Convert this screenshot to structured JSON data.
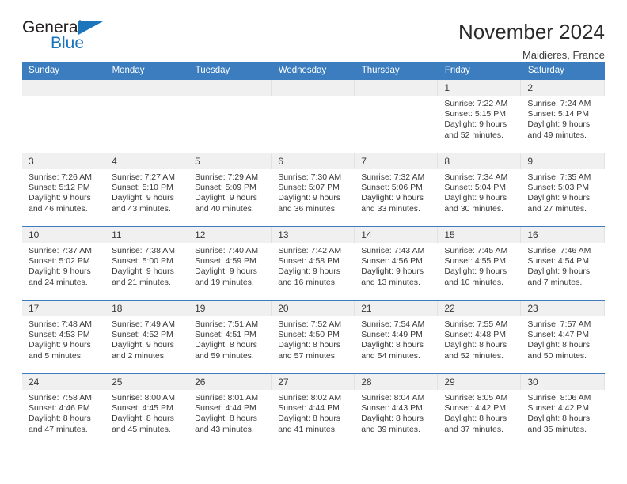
{
  "brand": {
    "name_top": "General",
    "name_bottom": "Blue",
    "accent_color": "#1b75bc"
  },
  "header": {
    "title": "November 2024",
    "subtitle": "Maidieres, France"
  },
  "calendar": {
    "header_color": "#3b7dbf",
    "weekday_headers": [
      "Sunday",
      "Monday",
      "Tuesday",
      "Wednesday",
      "Thursday",
      "Friday",
      "Saturday"
    ],
    "weeks": [
      [
        {
          "day": "",
          "sunrise": "",
          "sunset": "",
          "daylight": "",
          "empty": true
        },
        {
          "day": "",
          "sunrise": "",
          "sunset": "",
          "daylight": "",
          "empty": true
        },
        {
          "day": "",
          "sunrise": "",
          "sunset": "",
          "daylight": "",
          "empty": true
        },
        {
          "day": "",
          "sunrise": "",
          "sunset": "",
          "daylight": "",
          "empty": true
        },
        {
          "day": "",
          "sunrise": "",
          "sunset": "",
          "daylight": "",
          "empty": true
        },
        {
          "day": "1",
          "sunrise": "Sunrise: 7:22 AM",
          "sunset": "Sunset: 5:15 PM",
          "daylight": "Daylight: 9 hours and 52 minutes."
        },
        {
          "day": "2",
          "sunrise": "Sunrise: 7:24 AM",
          "sunset": "Sunset: 5:14 PM",
          "daylight": "Daylight: 9 hours and 49 minutes."
        }
      ],
      [
        {
          "day": "3",
          "sunrise": "Sunrise: 7:26 AM",
          "sunset": "Sunset: 5:12 PM",
          "daylight": "Daylight: 9 hours and 46 minutes."
        },
        {
          "day": "4",
          "sunrise": "Sunrise: 7:27 AM",
          "sunset": "Sunset: 5:10 PM",
          "daylight": "Daylight: 9 hours and 43 minutes."
        },
        {
          "day": "5",
          "sunrise": "Sunrise: 7:29 AM",
          "sunset": "Sunset: 5:09 PM",
          "daylight": "Daylight: 9 hours and 40 minutes."
        },
        {
          "day": "6",
          "sunrise": "Sunrise: 7:30 AM",
          "sunset": "Sunset: 5:07 PM",
          "daylight": "Daylight: 9 hours and 36 minutes."
        },
        {
          "day": "7",
          "sunrise": "Sunrise: 7:32 AM",
          "sunset": "Sunset: 5:06 PM",
          "daylight": "Daylight: 9 hours and 33 minutes."
        },
        {
          "day": "8",
          "sunrise": "Sunrise: 7:34 AM",
          "sunset": "Sunset: 5:04 PM",
          "daylight": "Daylight: 9 hours and 30 minutes."
        },
        {
          "day": "9",
          "sunrise": "Sunrise: 7:35 AM",
          "sunset": "Sunset: 5:03 PM",
          "daylight": "Daylight: 9 hours and 27 minutes."
        }
      ],
      [
        {
          "day": "10",
          "sunrise": "Sunrise: 7:37 AM",
          "sunset": "Sunset: 5:02 PM",
          "daylight": "Daylight: 9 hours and 24 minutes."
        },
        {
          "day": "11",
          "sunrise": "Sunrise: 7:38 AM",
          "sunset": "Sunset: 5:00 PM",
          "daylight": "Daylight: 9 hours and 21 minutes."
        },
        {
          "day": "12",
          "sunrise": "Sunrise: 7:40 AM",
          "sunset": "Sunset: 4:59 PM",
          "daylight": "Daylight: 9 hours and 19 minutes."
        },
        {
          "day": "13",
          "sunrise": "Sunrise: 7:42 AM",
          "sunset": "Sunset: 4:58 PM",
          "daylight": "Daylight: 9 hours and 16 minutes."
        },
        {
          "day": "14",
          "sunrise": "Sunrise: 7:43 AM",
          "sunset": "Sunset: 4:56 PM",
          "daylight": "Daylight: 9 hours and 13 minutes."
        },
        {
          "day": "15",
          "sunrise": "Sunrise: 7:45 AM",
          "sunset": "Sunset: 4:55 PM",
          "daylight": "Daylight: 9 hours and 10 minutes."
        },
        {
          "day": "16",
          "sunrise": "Sunrise: 7:46 AM",
          "sunset": "Sunset: 4:54 PM",
          "daylight": "Daylight: 9 hours and 7 minutes."
        }
      ],
      [
        {
          "day": "17",
          "sunrise": "Sunrise: 7:48 AM",
          "sunset": "Sunset: 4:53 PM",
          "daylight": "Daylight: 9 hours and 5 minutes."
        },
        {
          "day": "18",
          "sunrise": "Sunrise: 7:49 AM",
          "sunset": "Sunset: 4:52 PM",
          "daylight": "Daylight: 9 hours and 2 minutes."
        },
        {
          "day": "19",
          "sunrise": "Sunrise: 7:51 AM",
          "sunset": "Sunset: 4:51 PM",
          "daylight": "Daylight: 8 hours and 59 minutes."
        },
        {
          "day": "20",
          "sunrise": "Sunrise: 7:52 AM",
          "sunset": "Sunset: 4:50 PM",
          "daylight": "Daylight: 8 hours and 57 minutes."
        },
        {
          "day": "21",
          "sunrise": "Sunrise: 7:54 AM",
          "sunset": "Sunset: 4:49 PM",
          "daylight": "Daylight: 8 hours and 54 minutes."
        },
        {
          "day": "22",
          "sunrise": "Sunrise: 7:55 AM",
          "sunset": "Sunset: 4:48 PM",
          "daylight": "Daylight: 8 hours and 52 minutes."
        },
        {
          "day": "23",
          "sunrise": "Sunrise: 7:57 AM",
          "sunset": "Sunset: 4:47 PM",
          "daylight": "Daylight: 8 hours and 50 minutes."
        }
      ],
      [
        {
          "day": "24",
          "sunrise": "Sunrise: 7:58 AM",
          "sunset": "Sunset: 4:46 PM",
          "daylight": "Daylight: 8 hours and 47 minutes."
        },
        {
          "day": "25",
          "sunrise": "Sunrise: 8:00 AM",
          "sunset": "Sunset: 4:45 PM",
          "daylight": "Daylight: 8 hours and 45 minutes."
        },
        {
          "day": "26",
          "sunrise": "Sunrise: 8:01 AM",
          "sunset": "Sunset: 4:44 PM",
          "daylight": "Daylight: 8 hours and 43 minutes."
        },
        {
          "day": "27",
          "sunrise": "Sunrise: 8:02 AM",
          "sunset": "Sunset: 4:44 PM",
          "daylight": "Daylight: 8 hours and 41 minutes."
        },
        {
          "day": "28",
          "sunrise": "Sunrise: 8:04 AM",
          "sunset": "Sunset: 4:43 PM",
          "daylight": "Daylight: 8 hours and 39 minutes."
        },
        {
          "day": "29",
          "sunrise": "Sunrise: 8:05 AM",
          "sunset": "Sunset: 4:42 PM",
          "daylight": "Daylight: 8 hours and 37 minutes."
        },
        {
          "day": "30",
          "sunrise": "Sunrise: 8:06 AM",
          "sunset": "Sunset: 4:42 PM",
          "daylight": "Daylight: 8 hours and 35 minutes."
        }
      ]
    ]
  }
}
